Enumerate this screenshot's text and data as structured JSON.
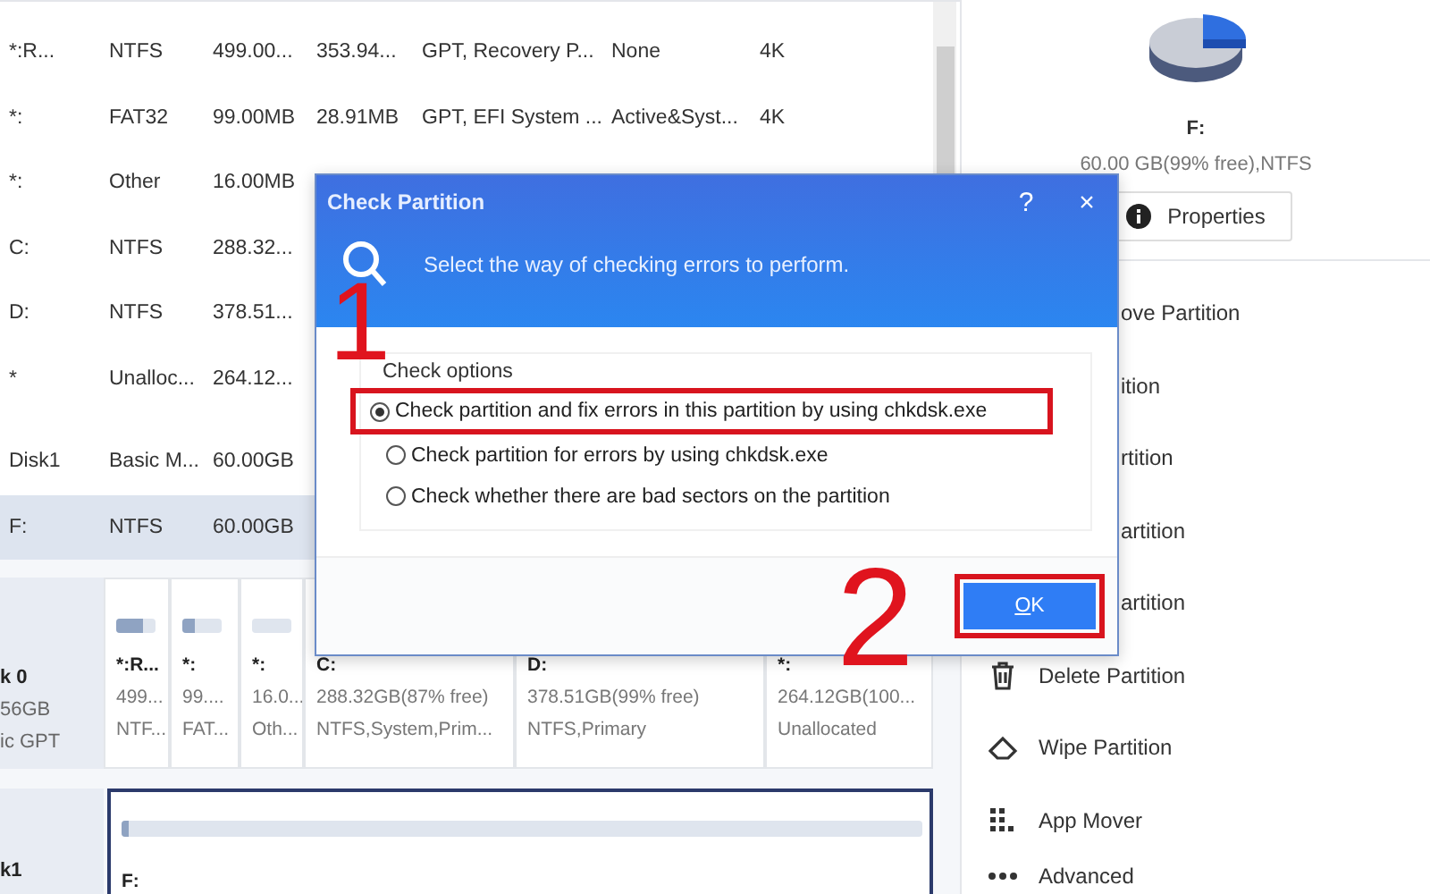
{
  "table": {
    "rows": [
      {
        "cells": [
          "*:R...",
          "NTFS",
          "499.00...",
          "353.94...",
          "GPT, Recovery P...",
          "None",
          "4K"
        ],
        "selected": false
      },
      {
        "cells": [
          "*:",
          "FAT32",
          "99.00MB",
          "28.91MB",
          "GPT, EFI System ...",
          "Active&Syst...",
          "4K"
        ],
        "selected": false
      },
      {
        "cells": [
          "*:",
          "Other",
          "16.00MB"
        ],
        "selected": false
      },
      {
        "cells": [
          "C:",
          "NTFS",
          "288.32..."
        ],
        "selected": false
      },
      {
        "cells": [
          "D:",
          "NTFS",
          "378.51..."
        ],
        "selected": false
      },
      {
        "cells": [
          "*",
          "Unalloc...",
          "264.12..."
        ],
        "selected": false
      },
      {
        "cells": [
          "Disk1",
          "Basic M...",
          "60.00GB"
        ],
        "selected": false,
        "kind": "disk"
      },
      {
        "cells": [
          "F:",
          "NTFS",
          "60.00GB"
        ],
        "selected": true
      }
    ]
  },
  "disk_map": {
    "disks": [
      {
        "label_lines": [
          "k 0",
          "56GB",
          "ic GPT"
        ],
        "partitions": [
          {
            "name": "*:R...",
            "size": "499...",
            "fs": "NTF...",
            "level": 0.7,
            "selected": false
          },
          {
            "name": "*:",
            "size": "99....",
            "fs": "FAT...",
            "level": 0.3,
            "selected": false
          },
          {
            "name": "*:",
            "size": "16.0...",
            "fs": "Oth...",
            "level": 0,
            "selected": false
          },
          {
            "name": "C:",
            "size": "288.32GB(87% free)",
            "fs": "NTFS,System,Prim...",
            "selected": false
          },
          {
            "name": "D:",
            "size": "378.51GB(99% free)",
            "fs": "NTFS,Primary",
            "selected": false
          },
          {
            "name": "*:",
            "size": "264.12GB(100...",
            "fs": "Unallocated",
            "selected": false
          }
        ]
      },
      {
        "label_lines": [
          "k1"
        ],
        "partitions": [
          {
            "name": "F:",
            "level": 0.01,
            "selected": true
          }
        ]
      }
    ]
  },
  "side_panel": {
    "drive": "F:",
    "info": "60.00 GB(99% free),NTFS",
    "properties_button": "Properties",
    "actions": [
      {
        "label": "ove Partition",
        "kind": "covered"
      },
      {
        "label": "ition",
        "kind": "covered"
      },
      {
        "label": "rtition",
        "kind": "covered"
      },
      {
        "label": "artition",
        "kind": "covered"
      },
      {
        "label": "artition",
        "kind": "covered"
      },
      {
        "label": "Delete Partition",
        "kind": "delete"
      },
      {
        "label": "Wipe Partition",
        "kind": "wipe"
      },
      {
        "label": "App Mover",
        "kind": "apps"
      },
      {
        "label": "Advanced",
        "kind": "more"
      }
    ]
  },
  "dialog": {
    "title": "Check Partition",
    "help": "?",
    "close": "×",
    "prompt": "Select the way of checking errors to perform.",
    "group_title": "Check options",
    "options": [
      {
        "label": "Check partition and fix errors in this partition by using chkdsk.exe",
        "selected": true
      },
      {
        "label": "Check partition for errors by using chkdsk.exe",
        "selected": false
      },
      {
        "label": "Check whether there are bad sectors on the partition",
        "selected": false
      }
    ],
    "ok_button": "OK"
  },
  "annotations": [
    {
      "text": "1"
    },
    {
      "text": "2"
    }
  ]
}
